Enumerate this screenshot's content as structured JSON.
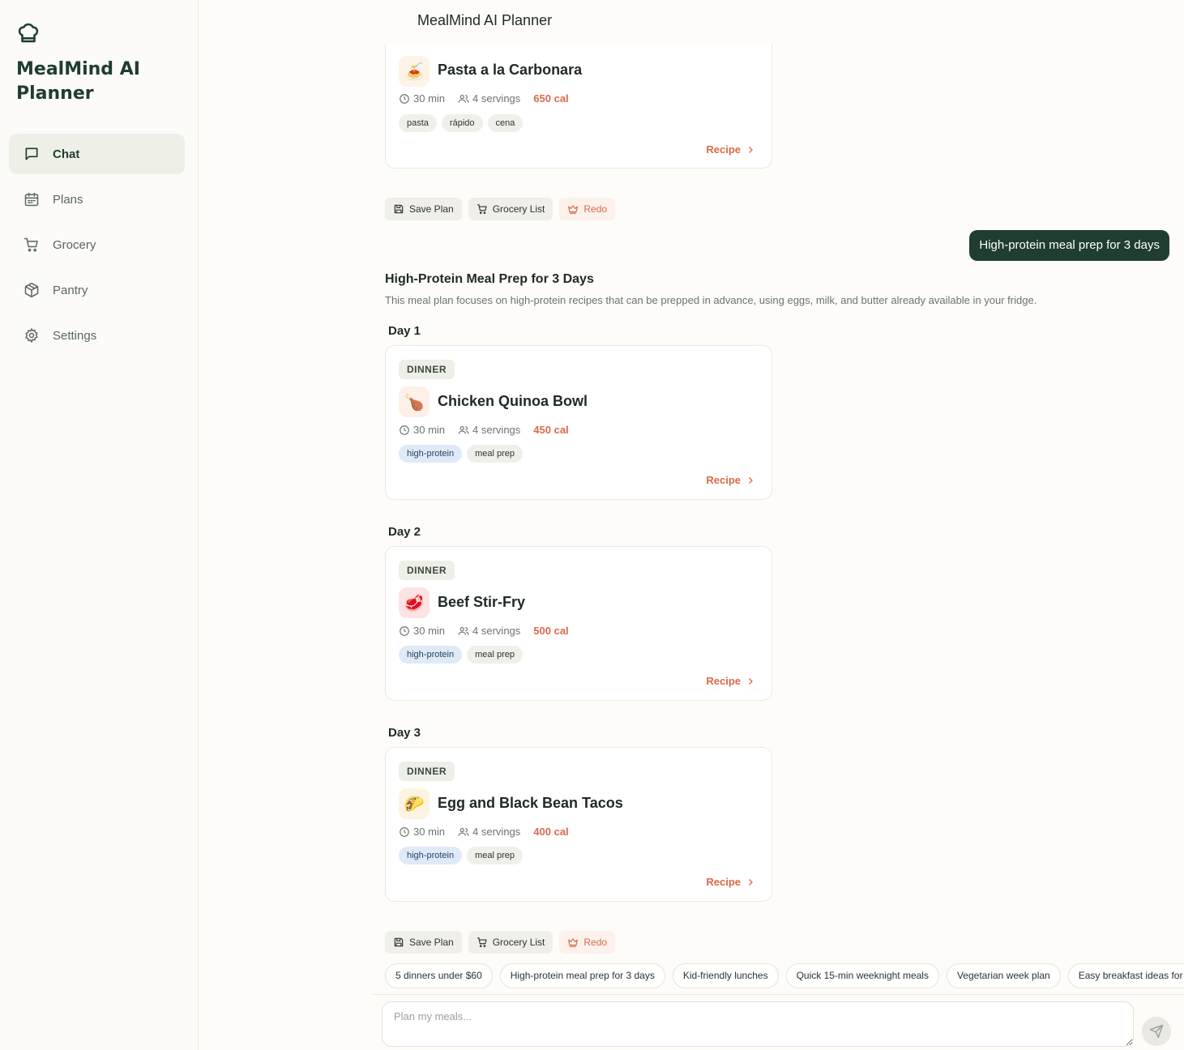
{
  "app": {
    "name": "MealMind AI Planner",
    "header_title": "MealMind AI Planner"
  },
  "sidebar": {
    "items": [
      {
        "label": "Chat",
        "icon": "chat-icon",
        "active": true
      },
      {
        "label": "Plans",
        "icon": "calendar-icon"
      },
      {
        "label": "Grocery",
        "icon": "cart-icon"
      },
      {
        "label": "Pantry",
        "icon": "box-icon"
      },
      {
        "label": "Settings",
        "icon": "gear-icon"
      }
    ]
  },
  "previous_meal": {
    "title": "Pasta a la Carbonara",
    "time": "30 min",
    "servings": "4 servings",
    "calories": "650 cal",
    "tags": [
      "pasta",
      "rápido",
      "cena"
    ],
    "recipe_label": "Recipe",
    "icon": "spaghetti-emoji"
  },
  "actions_top": {
    "save": "Save Plan",
    "grocery": "Grocery List",
    "redo": "Redo"
  },
  "user_message": "High-protein meal prep for 3 days",
  "plan": {
    "title": "High-Protein Meal Prep for 3 Days",
    "description": "This meal plan focuses on high-protein recipes that can be prepped in advance, using eggs, milk, and butter already available in your fridge.",
    "days": [
      {
        "label": "Day 1",
        "meal_type": "DINNER",
        "title": "Chicken Quinoa Bowl",
        "time": "30 min",
        "servings": "4 servings",
        "calories": "450 cal",
        "tags": [
          "high-protein",
          "meal prep"
        ],
        "recipe_label": "Recipe",
        "icon": "poultry-leg-emoji"
      },
      {
        "label": "Day 2",
        "meal_type": "DINNER",
        "title": "Beef Stir-Fry",
        "time": "30 min",
        "servings": "4 servings",
        "calories": "500 cal",
        "tags": [
          "high-protein",
          "meal prep"
        ],
        "recipe_label": "Recipe",
        "icon": "meat-emoji"
      },
      {
        "label": "Day 3",
        "meal_type": "DINNER",
        "title": "Egg and Black Bean Tacos",
        "time": "30 min",
        "servings": "4 servings",
        "calories": "400 cal",
        "tags": [
          "high-protein",
          "meal prep"
        ],
        "recipe_label": "Recipe",
        "icon": "taco-emoji"
      }
    ]
  },
  "actions_bottom": {
    "save": "Save Plan",
    "grocery": "Grocery List",
    "redo": "Redo"
  },
  "suggestions": [
    "5 dinners under $60",
    "High-protein meal prep for 3 days",
    "Kid-friendly lunches",
    "Quick 15-min weeknight meals",
    "Vegetarian week plan",
    "Easy breakfast ideas for busy mornings"
  ],
  "composer": {
    "placeholder": "Plan my meals..."
  },
  "colors": {
    "brand": "#1f3d30",
    "accent": "#d9694a",
    "tag_blue": "#dfeaf8"
  }
}
